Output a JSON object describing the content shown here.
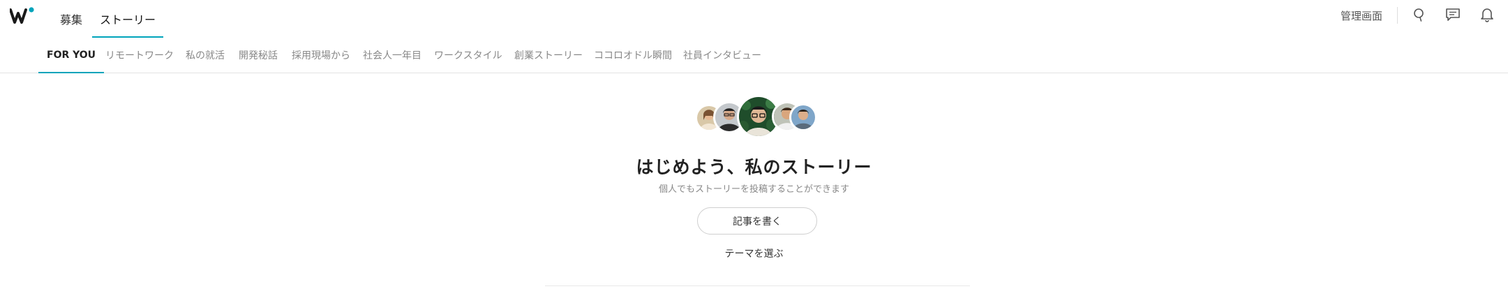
{
  "brand": {
    "logo_icon": "wantedly-logo-icon",
    "accent": "#00a4bb"
  },
  "header": {
    "tabs": [
      {
        "label": "募集",
        "active": false
      },
      {
        "label": "ストーリー",
        "active": true
      }
    ],
    "admin_label": "管理画面",
    "icons": [
      "search-icon",
      "message-icon",
      "bell-icon"
    ]
  },
  "subnav": {
    "tabs": [
      {
        "label": "FOR YOU",
        "active": true
      },
      {
        "label": "リモートワーク",
        "active": false
      },
      {
        "label": "私の就活",
        "active": false
      },
      {
        "label": "開発秘話",
        "active": false
      },
      {
        "label": "採用現場から",
        "active": false
      },
      {
        "label": "社会人一年目",
        "active": false
      },
      {
        "label": "ワークスタイル",
        "active": false
      },
      {
        "label": "創業ストーリー",
        "active": false
      },
      {
        "label": "ココロオドル瞬間",
        "active": false
      },
      {
        "label": "社員インタビュー",
        "active": false
      }
    ]
  },
  "hero": {
    "title": "はじめよう、私のストーリー",
    "subtitle": "個人でもストーリーを投稿することができます",
    "write_button": "記事を書く",
    "theme_link": "テーマを選ぶ"
  }
}
